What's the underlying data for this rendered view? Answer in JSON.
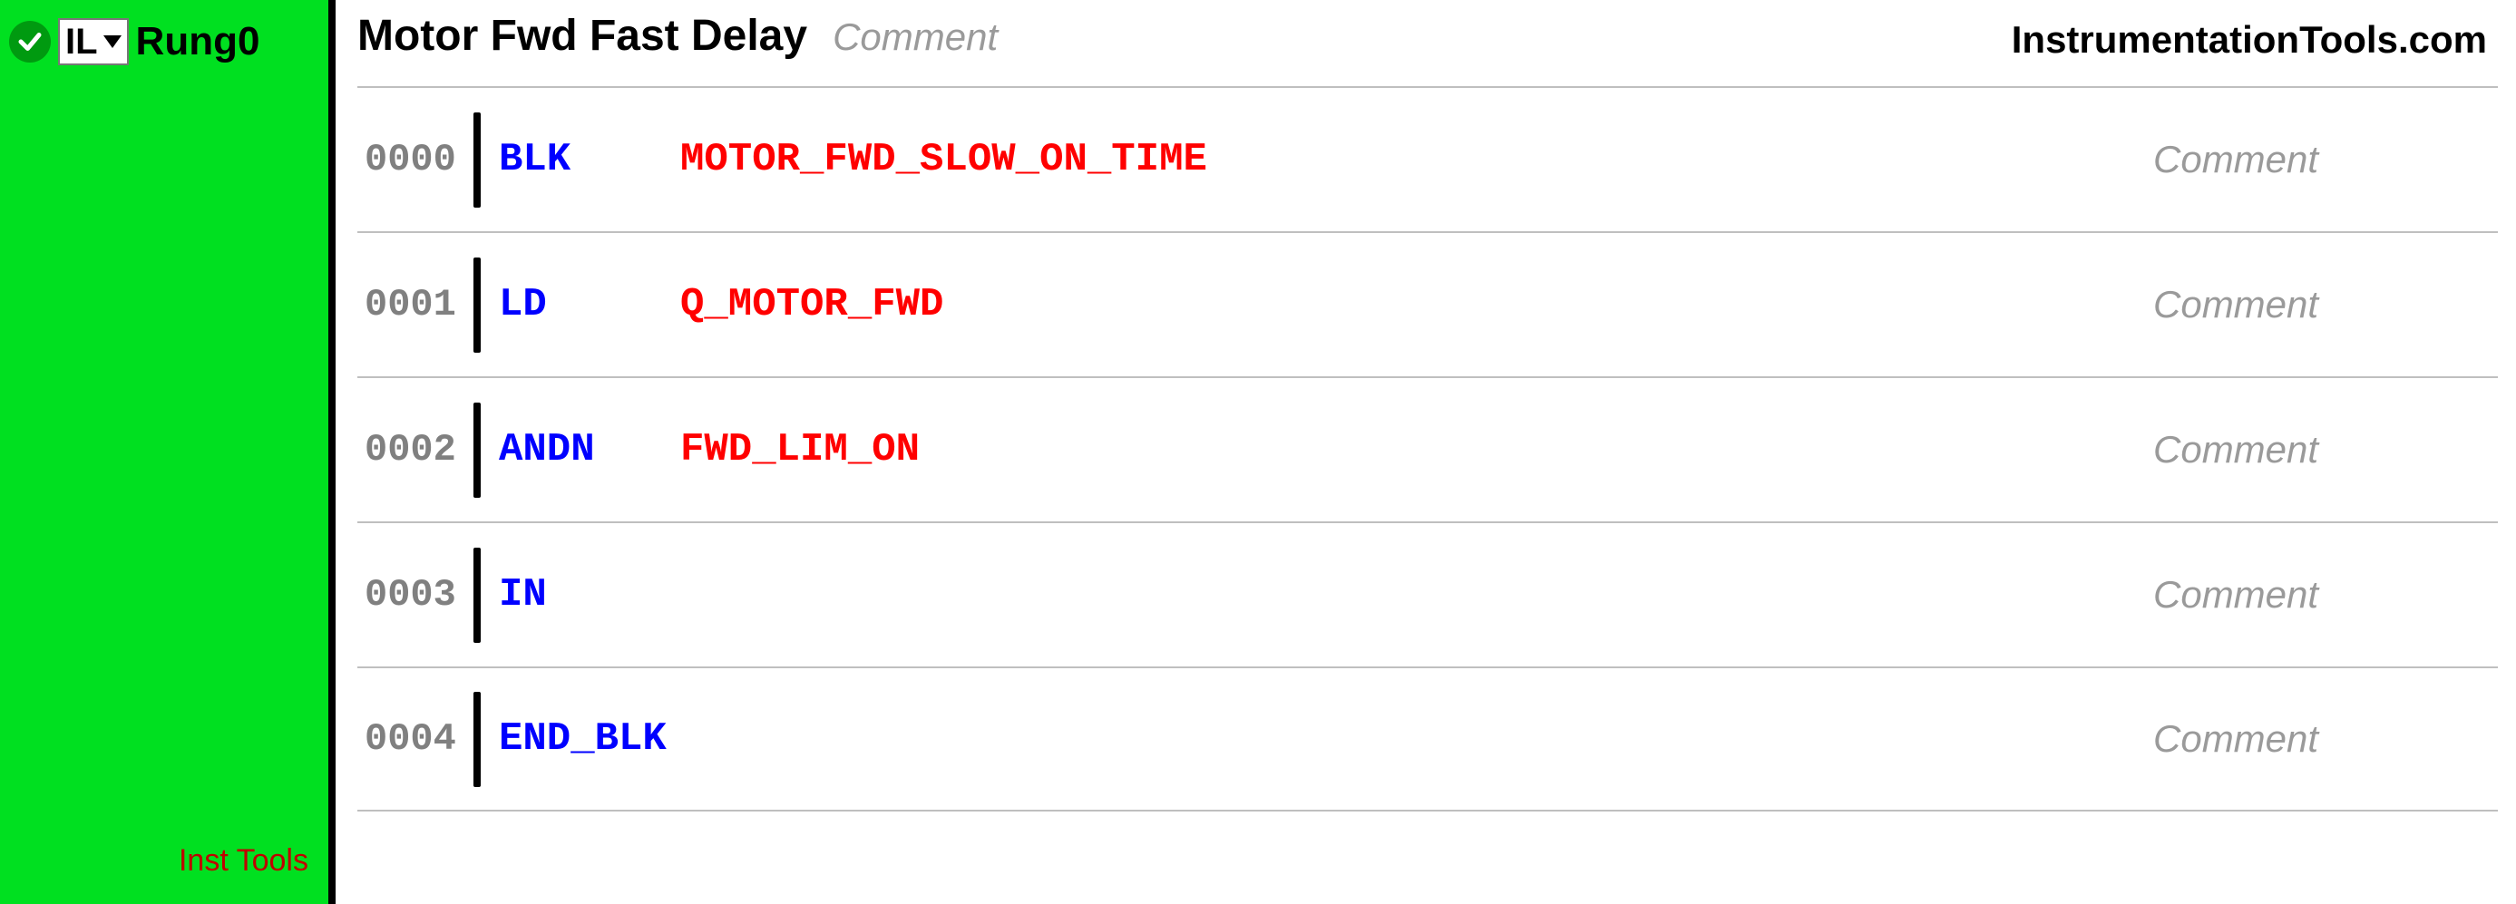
{
  "sidebar": {
    "language": "IL",
    "rung_label": "Rung0",
    "watermark": "Inst Tools"
  },
  "header": {
    "title": "Motor Fwd Fast Delay",
    "comment_placeholder": "Comment",
    "brand_url": "InstrumentationTools.com"
  },
  "il_lines": [
    {
      "num": "0000",
      "opcode": "BLK",
      "operand": "MOTOR_FWD_SLOW_ON_TIME",
      "comment": "Comment"
    },
    {
      "num": "0001",
      "opcode": "LD",
      "operand": "Q_MOTOR_FWD",
      "comment": "Comment"
    },
    {
      "num": "0002",
      "opcode": "ANDN",
      "operand": "FWD_LIM_ON",
      "comment": "Comment"
    },
    {
      "num": "0003",
      "opcode": "IN",
      "operand": "",
      "comment": "Comment"
    },
    {
      "num": "0004",
      "opcode": "END_BLK",
      "operand": "",
      "comment": "Comment"
    }
  ]
}
